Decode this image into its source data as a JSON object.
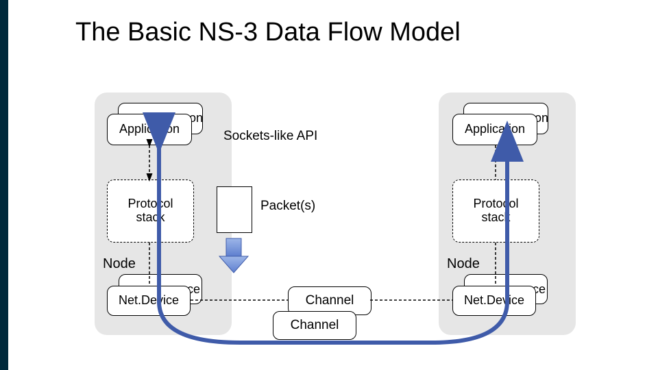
{
  "title": "The Basic NS-3 Data Flow Model",
  "left_node": {
    "app_back_suffix": "on",
    "app_front": "Application",
    "proto": "Protocol\nstack",
    "node_label": "Node",
    "nd_back_suffix": "ce",
    "nd_front": "Net.Device"
  },
  "right_node": {
    "app_back_suffix": "on",
    "app_front": "Application",
    "proto": "Protocol\nstack",
    "node_label": "Node",
    "nd_back_suffix": "ce",
    "nd_front": "Net.Device"
  },
  "labels": {
    "sockets": "Sockets-like API",
    "packets": "Packet(s)"
  },
  "channels": {
    "top": "Channel",
    "bottom": "Channel"
  }
}
